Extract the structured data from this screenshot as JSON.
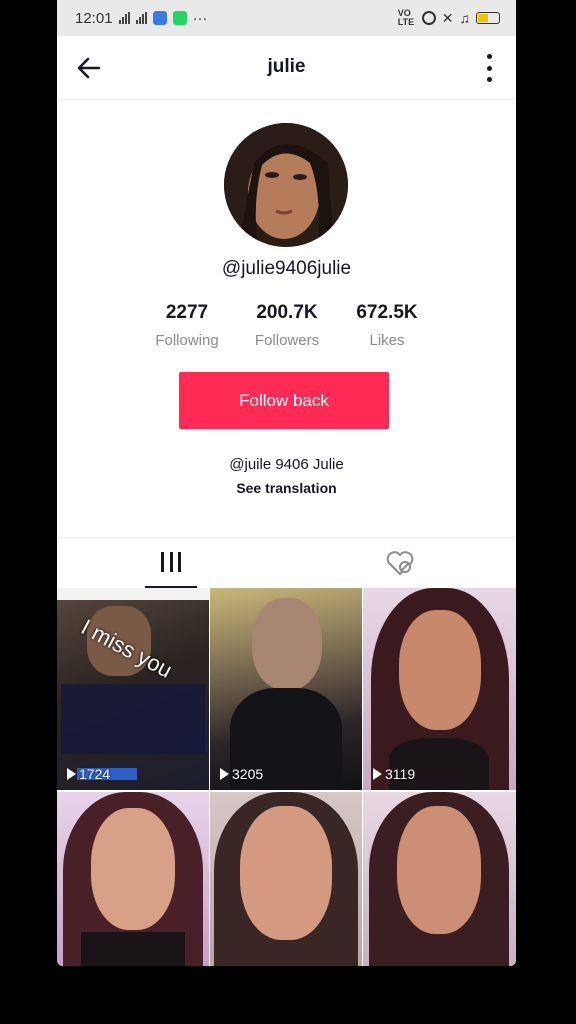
{
  "status_bar": {
    "time": "12:01",
    "extra": "···",
    "network_label": "VO LTE"
  },
  "header": {
    "title": "julie"
  },
  "profile": {
    "username": "@julie9406julie",
    "stats": [
      {
        "value": "2277",
        "label": "Following"
      },
      {
        "value": "200.7K",
        "label": "Followers"
      },
      {
        "value": "672.5K",
        "label": "Likes"
      }
    ],
    "follow_button": "Follow back",
    "bio": "@juile 9406 Julie",
    "see_translation": "See translation"
  },
  "colors": {
    "accent": "#fe2c55",
    "text": "#161823",
    "muted": "#8a8b91"
  },
  "videos": [
    {
      "views": "1724",
      "overlay": "I miss you"
    },
    {
      "views": "3205"
    },
    {
      "views": "3119"
    },
    {
      "views": ""
    },
    {
      "views": ""
    },
    {
      "views": ""
    }
  ]
}
